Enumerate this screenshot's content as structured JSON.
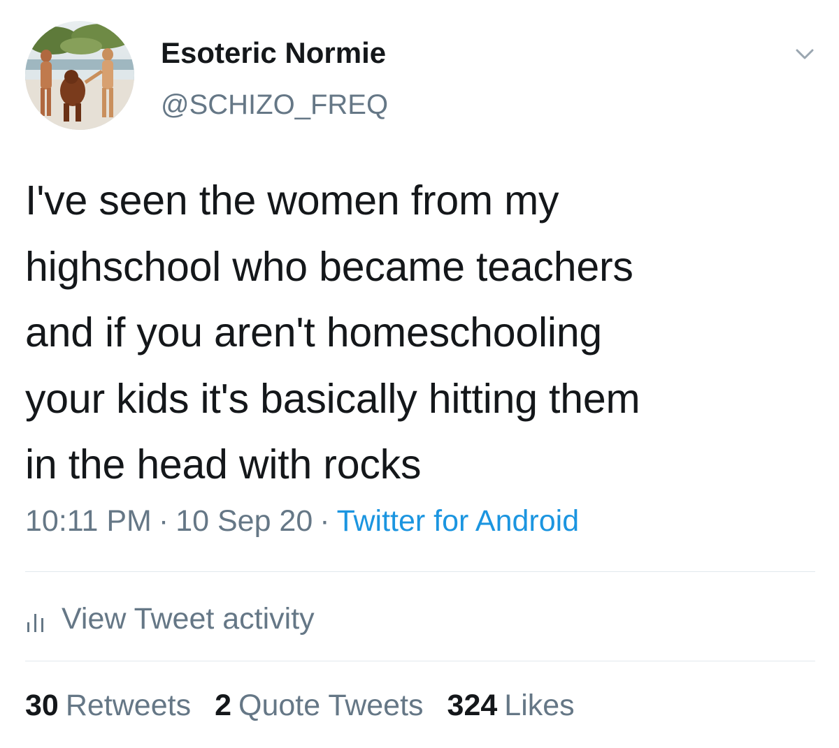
{
  "author": {
    "display_name": "Esoteric Normie",
    "handle": "@SCHIZO_FREQ",
    "avatar_icon": "beach-photo-avatar"
  },
  "tweet": {
    "text": "I've seen the women from my\nhighschool who became teachers\nand if you aren't homeschooling\nyour kids it's basically hitting them\nin the head with rocks"
  },
  "meta": {
    "time": "10:11 PM",
    "date": "10 Sep 20",
    "separator": "·",
    "source": "Twitter for Android"
  },
  "activity": {
    "label": "View Tweet activity",
    "icon": "bar-chart-icon"
  },
  "stats": {
    "retweets_count": "30",
    "retweets_label": "Retweets",
    "quotes_count": "2",
    "quotes_label": "Quote Tweets",
    "likes_count": "324",
    "likes_label": "Likes"
  },
  "colors": {
    "text_primary": "#14171a",
    "text_secondary": "#657786",
    "link": "#1b95e0",
    "divider": "#e1e8ed"
  }
}
